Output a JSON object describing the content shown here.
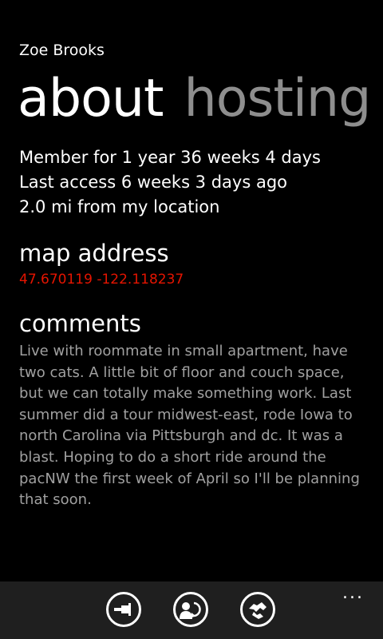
{
  "header": {
    "app_title": "Zoe Brooks"
  },
  "pivot": {
    "tabs": [
      "about",
      "hosting"
    ],
    "active_index": 0
  },
  "about": {
    "member_for": "Member for 1 year 36 weeks 4 days",
    "last_access": "Last access 6 weeks 3 days ago",
    "distance": "2.0 mi from my location",
    "map_header": "map address",
    "map_coordinates": "47.670119 -122.118237",
    "comments_header": "comments",
    "comments_text": "Live with roommate in small apartment, have two cats. A little bit of floor and couch space, but we can totally make something work. Last summer did a tour midwest-east, rode Iowa to north Carolina via Pittsburgh and dc. It was a blast. Hoping to do a short ride around the pacNW the first week of April so I'll be planning that soon."
  },
  "appbar": {
    "buttons": [
      "pin-icon",
      "contact-history-icon",
      "handshake-icon"
    ],
    "more": "..."
  },
  "colors": {
    "accent": "#e51400",
    "background": "#000000",
    "appbar": "#1f1f1f",
    "secondary_text": "#a0a0a0",
    "inactive_pivot": "#8e8e8e"
  }
}
